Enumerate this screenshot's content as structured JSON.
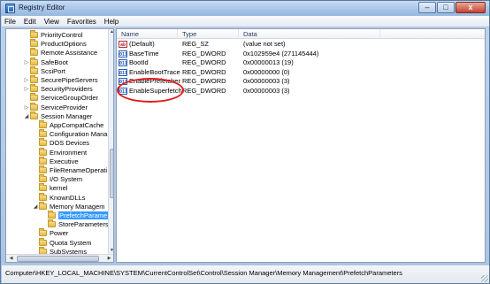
{
  "window": {
    "title": "Registry Editor",
    "buttons": {
      "minimize": "–",
      "maximize": "□",
      "close": "x"
    }
  },
  "menu": [
    "File",
    "Edit",
    "View",
    "Favorites",
    "Help"
  ],
  "tree": {
    "items": [
      {
        "label": "PriorityControl",
        "depth": 3,
        "expander": ""
      },
      {
        "label": "ProductOptions",
        "depth": 3,
        "expander": ""
      },
      {
        "label": "Remote Assistance",
        "depth": 3,
        "expander": ""
      },
      {
        "label": "SafeBoot",
        "depth": 3,
        "expander": "▷"
      },
      {
        "label": "ScsiPort",
        "depth": 3,
        "expander": ""
      },
      {
        "label": "SecurePipeServers",
        "depth": 3,
        "expander": "▷"
      },
      {
        "label": "SecurityProviders",
        "depth": 3,
        "expander": "▷"
      },
      {
        "label": "ServiceGroupOrder",
        "depth": 3,
        "expander": ""
      },
      {
        "label": "ServiceProvider",
        "depth": 3,
        "expander": "▷"
      },
      {
        "label": "Session Manager",
        "depth": 3,
        "expander": "◢"
      },
      {
        "label": "AppCompatCache",
        "depth": 4,
        "expander": ""
      },
      {
        "label": "Configuration Mana",
        "depth": 4,
        "expander": ""
      },
      {
        "label": "DOS Devices",
        "depth": 4,
        "expander": ""
      },
      {
        "label": "Environment",
        "depth": 4,
        "expander": ""
      },
      {
        "label": "Executive",
        "depth": 4,
        "expander": ""
      },
      {
        "label": "FileRenameOperati",
        "depth": 4,
        "expander": ""
      },
      {
        "label": "I/O System",
        "depth": 4,
        "expander": ""
      },
      {
        "label": "kernel",
        "depth": 4,
        "expander": ""
      },
      {
        "label": "KnownDLLs",
        "depth": 4,
        "expander": ""
      },
      {
        "label": "Memory Managem",
        "depth": 4,
        "expander": "◢"
      },
      {
        "label": "PrefetchParame",
        "depth": 5,
        "expander": "",
        "selected": true
      },
      {
        "label": "StoreParameters",
        "depth": 5,
        "expander": ""
      },
      {
        "label": "Power",
        "depth": 4,
        "expander": ""
      },
      {
        "label": "Quota System",
        "depth": 4,
        "expander": ""
      },
      {
        "label": "SubSystems",
        "depth": 4,
        "expander": ""
      }
    ]
  },
  "list": {
    "columns": [
      "Name",
      "Type",
      "Data"
    ],
    "rows": [
      {
        "icon": "string-value-icon",
        "icon_text": "ab",
        "name": "(Default)",
        "type": "REG_SZ",
        "data": "(value not set)"
      },
      {
        "icon": "binary-value-icon",
        "icon_text": "011",
        "name": "BaseTime",
        "type": "REG_DWORD",
        "data": "0x102959e4 (271145444)"
      },
      {
        "icon": "binary-value-icon",
        "icon_text": "011",
        "name": "BootId",
        "type": "REG_DWORD",
        "data": "0x00000013 (19)"
      },
      {
        "icon": "binary-value-icon",
        "icon_text": "011",
        "name": "EnableBootTrace",
        "type": "REG_DWORD",
        "data": "0x00000000 (0)"
      },
      {
        "icon": "binary-value-icon",
        "icon_text": "011",
        "name": "EnablePrefetcher",
        "type": "REG_DWORD",
        "data": "0x00000003 (3)"
      },
      {
        "icon": "binary-value-icon",
        "icon_text": "011",
        "name": "EnableSuperfetch",
        "type": "REG_DWORD",
        "data": "0x00000003 (3)"
      }
    ]
  },
  "status": {
    "path": "Computer\\HKEY_LOCAL_MACHINE\\SYSTEM\\CurrentControlSet\\Control\\Session Manager\\Memory Management\\PrefetchParameters"
  },
  "colors": {
    "selection": "#3399ff",
    "annotation": "#e31a1c"
  }
}
